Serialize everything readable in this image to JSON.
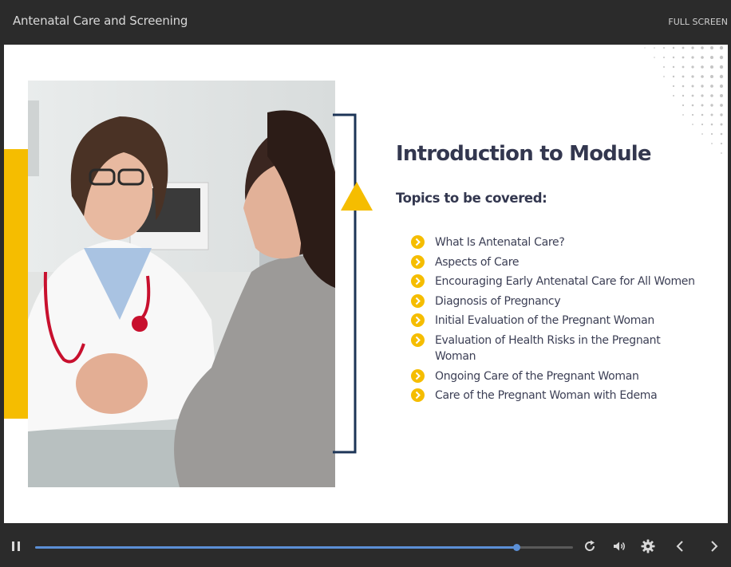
{
  "header": {
    "course_title": "Antenatal Care and Screening",
    "fullscreen_label": "FULL SCREEN"
  },
  "slide": {
    "heading": "Introduction to Module",
    "subheading": "Topics to be covered:",
    "topics": [
      "What Is Antenatal Care?",
      "Aspects of Care",
      "Encouraging Early Antenatal Care for All Women",
      "Diagnosis of Pregnancy",
      "Initial Evaluation of the Pregnant Woman",
      "Evaluation of Health Risks in the Pregnant Woman",
      "Ongoing Care of the Pregnant Woman",
      "Care of the Pregnant Woman with Edema"
    ]
  },
  "player": {
    "progress": 0.895
  },
  "colors": {
    "accent": "#f5bd00",
    "navy": "#1d3557",
    "heading": "#33374f",
    "progress": "#5b8fd6"
  },
  "icons": [
    "pause-icon",
    "replay-icon",
    "volume-icon",
    "gear-icon",
    "chevron-left-icon",
    "chevron-right-icon"
  ]
}
